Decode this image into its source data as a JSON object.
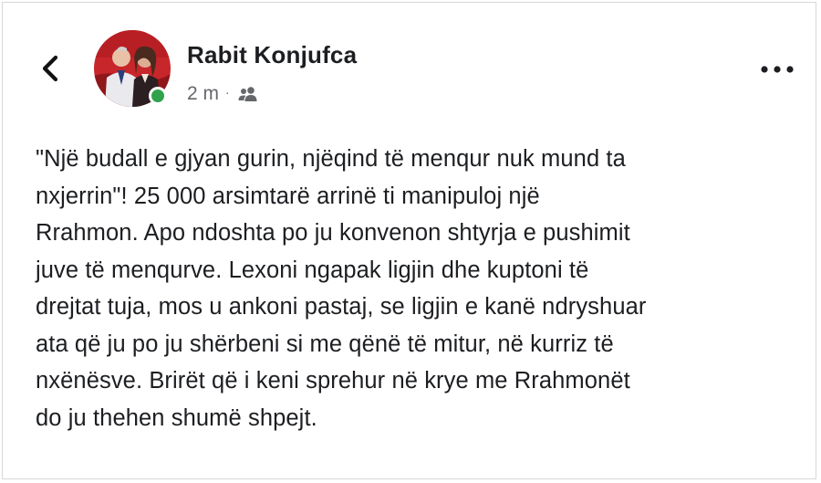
{
  "post": {
    "author": {
      "name": "Rabit Konjufca",
      "online": true
    },
    "meta": {
      "time": "2 m",
      "separator": "·",
      "audience_icon": "friends-icon"
    },
    "text": "\"Një budall e gjyan gurin, njëqind të menqur nuk mund ta\nnxjerrin\"! 25 000 arsimtarë arrinë ti manipuloj një\nRrahmon. Apo ndoshta po ju konvenon shtyrja e pushimit\njuve të menqurve. Lexoni ngapak ligjin dhe kuptoni të\ndrejtat tuja, mos u ankoni pastaj, se ligjin e kanë ndryshuar\nata që ju po ju shërbeni si me qënë të mitur, në kurriz të\nnxënësve. Brirët që i keni sprehur në krye me Rrahmonët\ndo ju thehen shumë shpejt."
  },
  "icons": {
    "back": "chevron-left-icon",
    "more": "more-horizontal-icon"
  },
  "colors": {
    "online": "#31a24c",
    "text": "#1c1e21",
    "secondary": "#65676b"
  }
}
